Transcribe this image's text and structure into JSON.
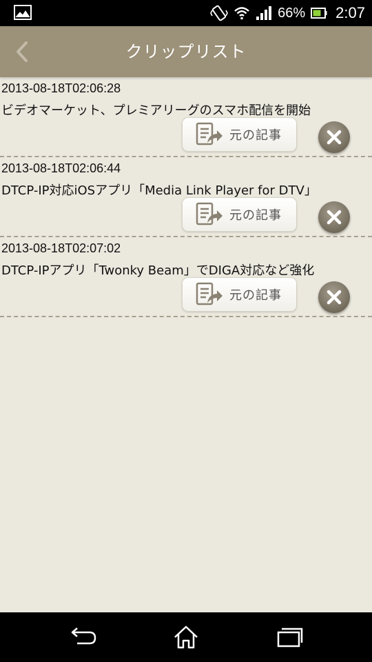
{
  "status_bar": {
    "battery_percent": "66%",
    "time": "2:07",
    "icons": [
      "picture-icon",
      "vibrate-icon",
      "wifi-icon",
      "signal-icon",
      "battery-icon"
    ]
  },
  "header": {
    "title": "クリップリスト",
    "back_icon": "chevron-left-icon",
    "color": "#9c9179"
  },
  "clips": [
    {
      "date": "2013-08-18T02:06:28",
      "title": "ビデオマーケット、プレミアリーグのスマホ配信を開始",
      "source_label": "元の記事"
    },
    {
      "date": "2013-08-18T02:06:44",
      "title": "DTCP-IP対応iOSアプリ「Media Link Player for DTV」",
      "source_label": "元の記事"
    },
    {
      "date": "2013-08-18T02:07:02",
      "title": "DTCP-IPアプリ「Twonky Beam」でDIGA対応など強化",
      "source_label": "元の記事"
    }
  ],
  "nav_bar": {
    "icons": [
      "back-arrow-icon",
      "home-icon",
      "recent-apps-icon"
    ]
  }
}
